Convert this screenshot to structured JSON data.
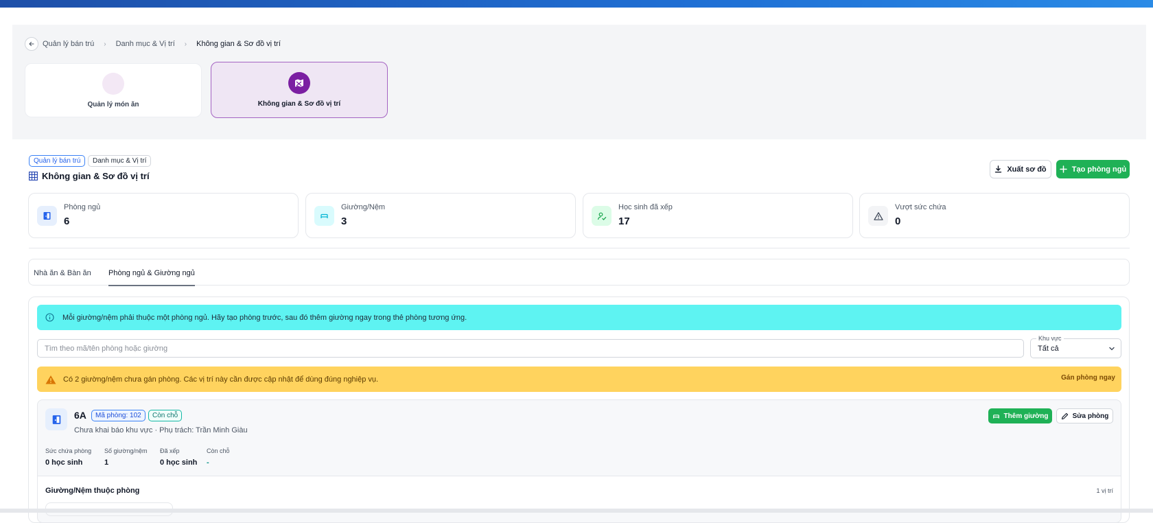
{
  "breadcrumb": {
    "items": [
      "Quản lý bán trú",
      "Danh mục & Vị trí",
      "Không gian & Sơ đồ vị trí"
    ]
  },
  "modules": [
    {
      "label": "Quản lý món ăn",
      "active": false
    },
    {
      "label": "Không gian & Sơ đồ vị trí",
      "active": true
    }
  ],
  "header": {
    "tags": [
      "Quản lý bán trú",
      "Danh mục & Vị trí"
    ],
    "title": "Không gian & Sơ đồ vị trí",
    "export_label": "Xuất sơ đồ",
    "create_label": "Tạo phòng ngủ"
  },
  "stats": [
    {
      "label": "Phòng ngủ",
      "value": "6",
      "icon": "door-icon",
      "color": "#2563eb"
    },
    {
      "label": "Giường/Nệm",
      "value": "3",
      "icon": "bed-icon",
      "color": "#06b6d4"
    },
    {
      "label": "Học sinh đã xếp",
      "value": "17",
      "icon": "user-check-icon",
      "color": "#16a34a"
    },
    {
      "label": "Vượt sức chứa",
      "value": "0",
      "icon": "warning-icon",
      "color": "#6b7280"
    }
  ],
  "tabs": [
    {
      "label": "Nhà ăn & Bàn ăn",
      "active": false
    },
    {
      "label": "Phòng ngủ & Giường ngủ",
      "active": true
    }
  ],
  "info": {
    "text": "Mỗi giường/nệm phải thuộc một phòng ngủ. Hãy tạo phòng trước, sau đó thêm giường ngay trong thẻ phòng tương ứng."
  },
  "filters": {
    "search_placeholder": "Tìm theo mã/tên phòng hoặc giường",
    "area_label": "Khu vực",
    "area_value": "Tất cả"
  },
  "warning": {
    "text": "Có 2 giường/nệm chưa gán phòng. Các vị trí này cần được cập nhật để dùng đúng nghiệp vụ.",
    "action": "Gán phòng ngay"
  },
  "room": {
    "name": "6A",
    "code_badge": "Mã phòng: 102",
    "status_badge": "Còn chỗ",
    "description": "Chưa khai báo khu vực · Phụ trách: Trần Minh Giàu",
    "add_bed_label": "Thêm giường",
    "edit_label": "Sửa phòng",
    "stats": [
      {
        "label": "Sức chứa phòng",
        "value": "0 học sinh"
      },
      {
        "label": "Số giường/nệm",
        "value": "1"
      },
      {
        "label": "Đã xếp",
        "value": "0 học sinh"
      },
      {
        "label": "Còn chỗ",
        "value": "-"
      }
    ],
    "beds_title": "Giường/Nệm thuộc phòng",
    "beds_count": "1 vị trí"
  }
}
